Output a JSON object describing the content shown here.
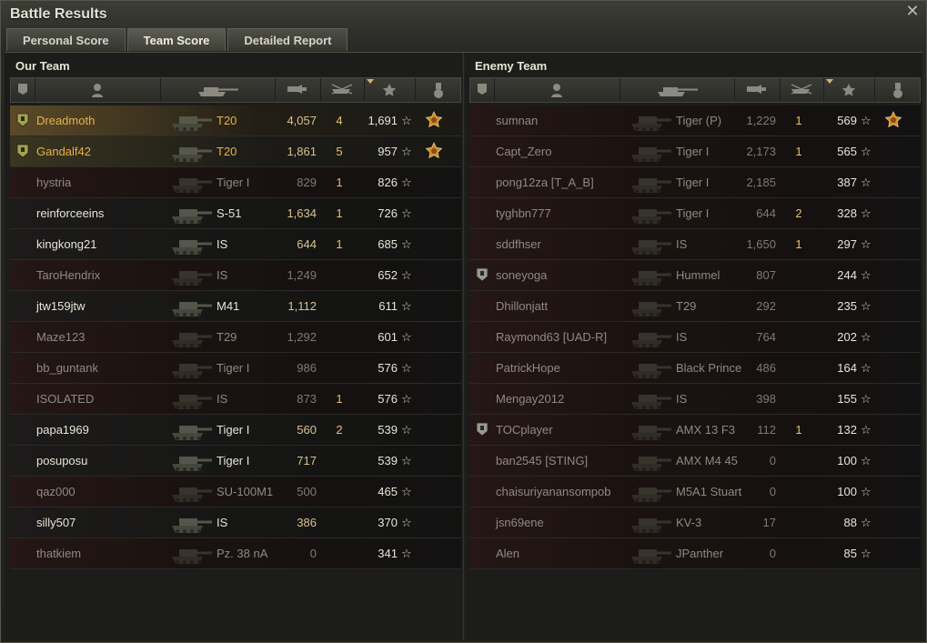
{
  "window": {
    "title": "Battle Results"
  },
  "tabs": [
    {
      "label": "Personal Score",
      "active": false
    },
    {
      "label": "Team Score",
      "active": true
    },
    {
      "label": "Detailed Report",
      "active": false
    }
  ],
  "our_team": {
    "title": "Our Team",
    "rows": [
      {
        "name": "Dreadmoth",
        "tank": "T20",
        "damage": "4,057",
        "kills": "4",
        "xp": "1,691",
        "status": "gold",
        "squad": true,
        "medal": true
      },
      {
        "name": "Gandalf42",
        "tank": "T20",
        "damage": "1,861",
        "kills": "5",
        "xp": "957",
        "status": "gold2",
        "squad": true,
        "medal": true
      },
      {
        "name": "hystria",
        "tank": "Tiger I",
        "damage": "829",
        "kills": "1",
        "xp": "826",
        "status": "dead"
      },
      {
        "name": "reinforceeins",
        "tank": "S-51",
        "damage": "1,634",
        "kills": "1",
        "xp": "726",
        "status": "alive"
      },
      {
        "name": "kingkong21",
        "tank": "IS",
        "damage": "644",
        "kills": "1",
        "xp": "685",
        "status": "alive"
      },
      {
        "name": "TaroHendrix",
        "tank": "IS",
        "damage": "1,249",
        "kills": "",
        "xp": "652",
        "status": "dead"
      },
      {
        "name": "jtw159jtw",
        "tank": "M41",
        "damage": "1,112",
        "kills": "",
        "xp": "611",
        "status": "alive"
      },
      {
        "name": "Maze123",
        "tank": "T29",
        "damage": "1,292",
        "kills": "",
        "xp": "601",
        "status": "dead"
      },
      {
        "name": "bb_guntank",
        "tank": "Tiger I",
        "damage": "986",
        "kills": "",
        "xp": "576",
        "status": "dead"
      },
      {
        "name": "ISOLATED",
        "tank": "IS",
        "damage": "873",
        "kills": "1",
        "xp": "576",
        "status": "dead"
      },
      {
        "name": "papa1969",
        "tank": "Tiger I",
        "damage": "560",
        "kills": "2",
        "xp": "539",
        "status": "alive"
      },
      {
        "name": "posuposu",
        "tank": "Tiger I",
        "damage": "717",
        "kills": "",
        "xp": "539",
        "status": "alive"
      },
      {
        "name": "qaz000",
        "tank": "SU-100M1",
        "damage": "500",
        "kills": "",
        "xp": "465",
        "status": "dead"
      },
      {
        "name": "silly507",
        "tank": "IS",
        "damage": "386",
        "kills": "",
        "xp": "370",
        "status": "alive"
      },
      {
        "name": "thatkiem",
        "tank": "Pz. 38 nA",
        "damage": "0",
        "kills": "",
        "xp": "341",
        "status": "dead"
      }
    ]
  },
  "enemy_team": {
    "title": "Enemy Team",
    "rows": [
      {
        "name": "sumnan",
        "tank": "Tiger (P)",
        "damage": "1,229",
        "kills": "1",
        "xp": "569",
        "status": "dead",
        "medal": true
      },
      {
        "name": "Capt_Zero",
        "tank": "Tiger I",
        "damage": "2,173",
        "kills": "1",
        "xp": "565",
        "status": "dead"
      },
      {
        "name": "pong12za [T_A_B]",
        "tank": "Tiger I",
        "damage": "2,185",
        "kills": "",
        "xp": "387",
        "status": "dead"
      },
      {
        "name": "tyghbn777",
        "tank": "Tiger I",
        "damage": "644",
        "kills": "2",
        "xp": "328",
        "status": "dead"
      },
      {
        "name": "sddfhser",
        "tank": "IS",
        "damage": "1,650",
        "kills": "1",
        "xp": "297",
        "status": "dead"
      },
      {
        "name": "soneyoga",
        "tank": "Hummel",
        "damage": "807",
        "kills": "",
        "xp": "244",
        "status": "dead",
        "squad": true
      },
      {
        "name": "Dhillonjatt",
        "tank": "T29",
        "damage": "292",
        "kills": "",
        "xp": "235",
        "status": "dead"
      },
      {
        "name": "Raymond63 [UAD-R]",
        "tank": "IS",
        "damage": "764",
        "kills": "",
        "xp": "202",
        "status": "dead"
      },
      {
        "name": "PatrickHope",
        "tank": "Black Prince",
        "damage": "486",
        "kills": "",
        "xp": "164",
        "status": "dead"
      },
      {
        "name": "Mengay2012",
        "tank": "IS",
        "damage": "398",
        "kills": "",
        "xp": "155",
        "status": "dead"
      },
      {
        "name": "TOCplayer",
        "tank": "AMX 13 F3",
        "damage": "112",
        "kills": "1",
        "xp": "132",
        "status": "dead",
        "squad": true
      },
      {
        "name": "ban2545 [STING]",
        "tank": "AMX M4 45",
        "damage": "0",
        "kills": "",
        "xp": "100",
        "status": "dead"
      },
      {
        "name": "chaisuriyanansompob",
        "tank": "M5A1 Stuart",
        "damage": "0",
        "kills": "",
        "xp": "100",
        "status": "dead"
      },
      {
        "name": "jsn69ene",
        "tank": "KV-3",
        "damage": "17",
        "kills": "",
        "xp": "88",
        "status": "dead"
      },
      {
        "name": "Alen",
        "tank": "JPanther",
        "damage": "0",
        "kills": "",
        "xp": "85",
        "status": "dead"
      }
    ]
  },
  "icons": {
    "close": "close-icon",
    "columns": [
      "squad-icon",
      "player-icon",
      "vehicle-icon",
      "damage-icon",
      "kills-icon",
      "experience-icon",
      "medal-icon"
    ],
    "star": "☆"
  },
  "colors": {
    "gold": "#e8b24a",
    "alive": "#e8e4d6",
    "dead": "#8f8a80"
  }
}
